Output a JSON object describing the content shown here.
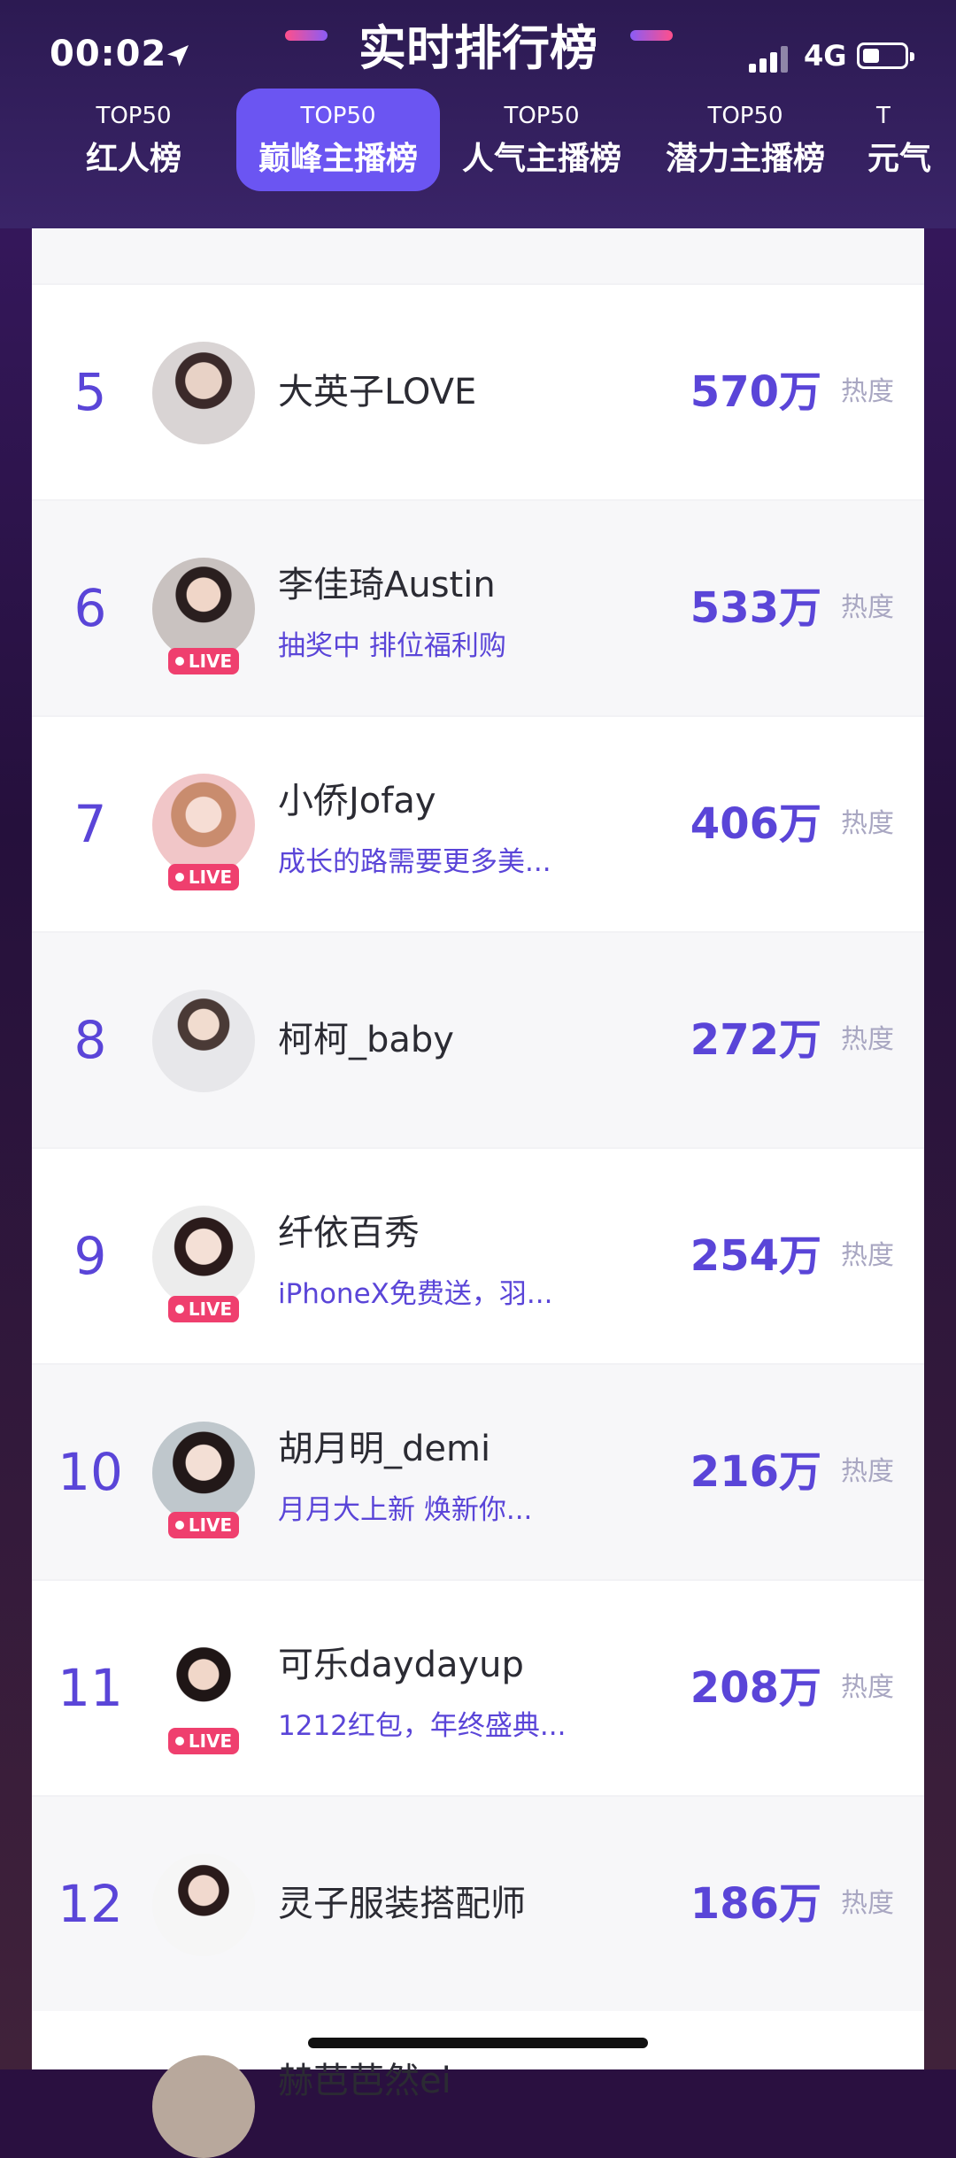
{
  "status_bar": {
    "time": "00:02",
    "network": "4G"
  },
  "header": {
    "title": "实时排行榜"
  },
  "tabs": [
    {
      "top": "TOP50",
      "label": "红人榜"
    },
    {
      "top": "TOP50",
      "label": "巅峰主播榜",
      "active": true
    },
    {
      "top": "TOP50",
      "label": "人气主播榜"
    },
    {
      "top": "TOP50",
      "label": "潜力主播榜"
    },
    {
      "top": "T",
      "label": "元气"
    }
  ],
  "live_badge": "LIVE",
  "heat_label": "热度",
  "rows": [
    {
      "rank": "5",
      "name": "大英子LOVE",
      "desc": "",
      "live": false,
      "score": "570万"
    },
    {
      "rank": "6",
      "name": "李佳琦Austin",
      "desc": "抽奖中 排位福利购",
      "live": true,
      "score": "533万"
    },
    {
      "rank": "7",
      "name": "小侨Jofay",
      "desc": "成长的路需要更多美...",
      "live": true,
      "score": "406万"
    },
    {
      "rank": "8",
      "name": "柯柯_baby",
      "desc": "",
      "live": false,
      "score": "272万"
    },
    {
      "rank": "9",
      "name": "纤依百秀",
      "desc": "iPhoneX免费送，羽...",
      "live": true,
      "score": "254万"
    },
    {
      "rank": "10",
      "name": "胡月明_demi",
      "desc": "月月大上新 焕新你...",
      "live": true,
      "score": "216万"
    },
    {
      "rank": "11",
      "name": "可乐daydayup",
      "desc": "1212红包，年终盛典...",
      "live": true,
      "score": "208万"
    },
    {
      "rank": "12",
      "name": "灵子服装搭配师",
      "desc": "",
      "live": false,
      "score": "186万"
    }
  ],
  "partial_row": {
    "name": "赫芭芭然ei"
  },
  "colors": {
    "accent": "#5a45d8",
    "active_tab": "#6b55f2",
    "live": "#ef3f6e",
    "header": "#2c1a52"
  }
}
